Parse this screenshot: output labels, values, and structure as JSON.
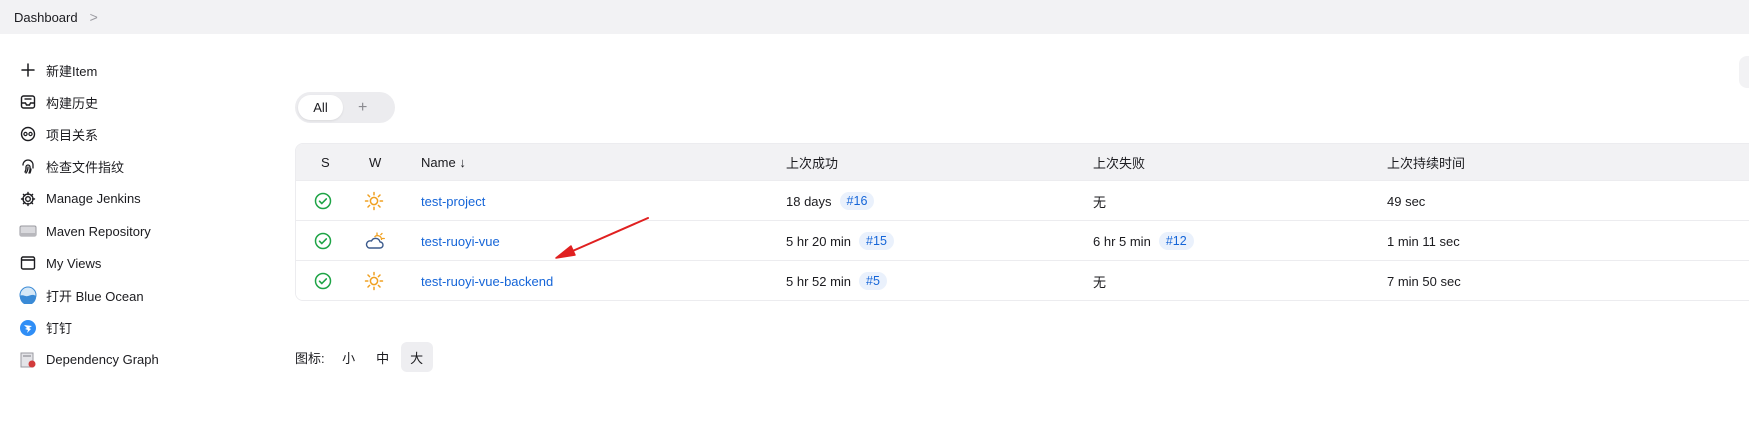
{
  "breadcrumb": {
    "items": [
      "Dashboard"
    ],
    "separator": ">"
  },
  "sidebar": {
    "items": [
      {
        "label": "新建Item",
        "icon": "plus-icon"
      },
      {
        "label": "构建历史",
        "icon": "inbox-icon"
      },
      {
        "label": "项目关系",
        "icon": "relationship-icon"
      },
      {
        "label": "检查文件指纹",
        "icon": "fingerprint-icon"
      },
      {
        "label": "Manage Jenkins",
        "icon": "gear-icon"
      },
      {
        "label": "Maven Repository",
        "icon": "drive-icon"
      },
      {
        "label": "My Views",
        "icon": "window-icon"
      },
      {
        "label": "打开 Blue Ocean",
        "icon": "blue-ocean-icon"
      },
      {
        "label": "钉钉",
        "icon": "dingtalk-icon"
      },
      {
        "label": "Dependency Graph",
        "icon": "dependency-graph-icon"
      }
    ]
  },
  "tabs": {
    "active": "All",
    "add_symbol": "+"
  },
  "table": {
    "headers": {
      "s": "S",
      "w": "W",
      "name": "Name",
      "sort_arrow": "↓",
      "last_success": "上次成功",
      "last_failure": "上次失败",
      "last_duration": "上次持续时间"
    },
    "rows": [
      {
        "status": "success",
        "weather": "sunny",
        "name": "test-project",
        "last_success": "18 days",
        "success_build": "#16",
        "last_failure": "无",
        "failure_build": "",
        "duration": "49 sec"
      },
      {
        "status": "success",
        "weather": "cloudy",
        "name": "test-ruoyi-vue",
        "last_success": "5 hr 20 min",
        "success_build": "#15",
        "last_failure": "6 hr 5 min",
        "failure_build": "#12",
        "duration": "1 min 11 sec"
      },
      {
        "status": "success",
        "weather": "sunny",
        "name": "test-ruoyi-vue-backend",
        "last_success": "5 hr 52 min",
        "success_build": "#5",
        "last_failure": "无",
        "failure_build": "",
        "duration": "7 min 50 sec"
      }
    ]
  },
  "icon_size": {
    "label": "图标:",
    "options": [
      "小",
      "中",
      "大"
    ],
    "selected": "大"
  },
  "colors": {
    "link": "#1565d8",
    "success": "#1ea446",
    "sun": "#f0a020",
    "arrow": "#e02020"
  }
}
